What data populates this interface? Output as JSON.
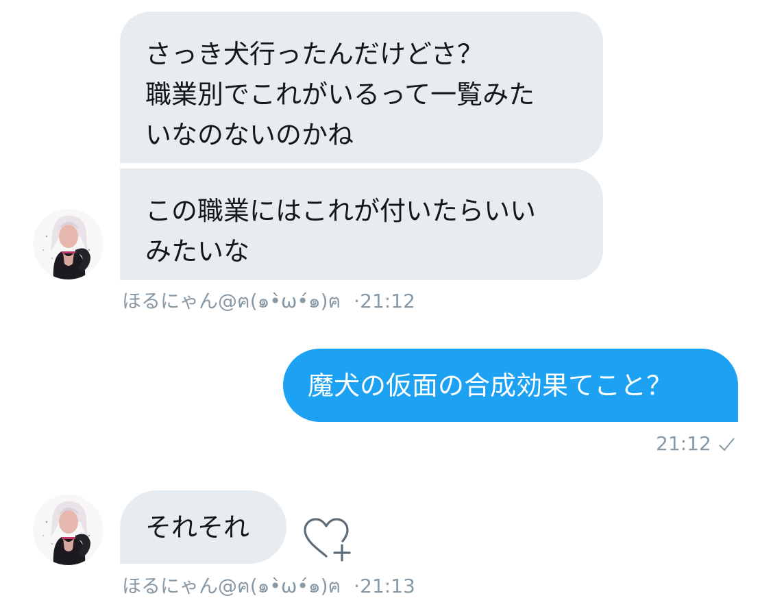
{
  "conversation": {
    "messages": [
      {
        "sender": "other",
        "text": "さっき犬行ったんだけどさ？\n職業別でこれがいるって一覧みた\nいなのないのかね"
      },
      {
        "sender": "other",
        "text": "この職業にはこれが付いたらいい\nみたいな",
        "name": "ほるにゃん@ฅ(๑•̀ω•́๑)ฅ",
        "time": "21:12"
      },
      {
        "sender": "me",
        "text": "魔犬の仮面の合成効果てこと？",
        "time": "21:12",
        "status_icon": "check-icon"
      },
      {
        "sender": "other",
        "text": "それそれ",
        "name": "ほるにゃん@ฅ(๑•̀ω•́๑)ฅ",
        "time": "21:13",
        "reaction_icon": "heart-add-icon"
      }
    ],
    "separator": "·"
  },
  "colors": {
    "incoming_bubble": "#e6ecf0",
    "outgoing_bubble": "#1da1f2",
    "meta_text": "#8899a6"
  }
}
